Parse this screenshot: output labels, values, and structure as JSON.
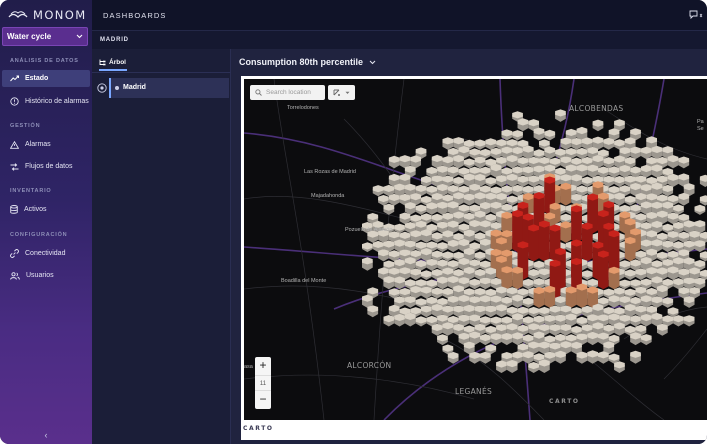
{
  "app": {
    "brand": "MONOM",
    "selector": "Water cycle"
  },
  "sidebar": {
    "sections": [
      {
        "title": "ANÁLISIS DE DATOS",
        "items": [
          {
            "label": "Estado",
            "icon": "trend-icon",
            "active": true
          },
          {
            "label": "Histórico de alarmas",
            "icon": "alarm-history-icon"
          }
        ]
      },
      {
        "title": "GESTIÓN",
        "items": [
          {
            "label": "Alarmas",
            "icon": "warning-icon"
          },
          {
            "label": "Flujos de datos",
            "icon": "flow-icon"
          }
        ]
      },
      {
        "title": "INVENTARIO",
        "items": [
          {
            "label": "Activos",
            "icon": "database-icon"
          }
        ]
      },
      {
        "title": "CONFIGURACIÓN",
        "items": [
          {
            "label": "Conectividad",
            "icon": "link-icon"
          },
          {
            "label": "Usuarios",
            "icon": "users-icon"
          }
        ]
      }
    ],
    "collapse": "‹"
  },
  "header": {
    "title": "DASHBOARDS",
    "breadcrumb": "MADRID"
  },
  "tree": {
    "tab": "Árbol",
    "nodes": [
      {
        "name": "Madrid",
        "selected": true
      }
    ]
  },
  "panel": {
    "title": "Consumption 80th percentile"
  },
  "map": {
    "search_placeholder": "Search location",
    "zoom_level": "11",
    "zoom_in": "+",
    "zoom_out": "−",
    "attribution": "CARTO",
    "cities": [
      "ALCOBENDAS",
      "ALCORCÓN",
      "LEGANÉS"
    ],
    "towns": [
      "Torrelodones",
      "Las Rozas de Madrid",
      "Majadahonda",
      "Pozuelo de Alarcón",
      "Boadilla del Monte",
      "Pa"
    ],
    "partial_labels": [
      "Se",
      "asa"
    ],
    "colors": {
      "low": "#d9d2c6",
      "mid": "#e39a6c",
      "high": "#c8231c"
    }
  }
}
